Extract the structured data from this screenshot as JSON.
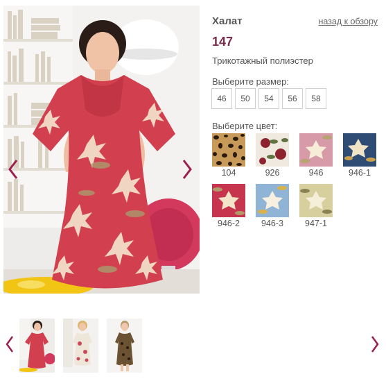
{
  "product": {
    "title": "Халат",
    "price": "147",
    "material": "Трикотажный полиэстер",
    "back_link": "назад к обзору"
  },
  "sizes": {
    "label": "Выберите размер:",
    "options": [
      "46",
      "50",
      "54",
      "56",
      "58"
    ]
  },
  "colors": {
    "label": "Выберите цвет:",
    "swatches": [
      {
        "code": "104",
        "pattern": "leopard",
        "base": "#c79a5a"
      },
      {
        "code": "926",
        "pattern": "floral",
        "base": "#efe9df"
      },
      {
        "code": "946",
        "pattern": "floral",
        "base": "#d79aa8"
      },
      {
        "code": "946-1",
        "pattern": "floral",
        "base": "#2f4c74"
      },
      {
        "code": "946-2",
        "pattern": "floral",
        "base": "#c7344d"
      },
      {
        "code": "946-3",
        "pattern": "floral",
        "base": "#8fb4d6"
      },
      {
        "code": "947-1",
        "pattern": "floral",
        "base": "#d7cf9e"
      }
    ]
  },
  "gallery": {
    "main_image": "model in red floral robe",
    "thumbnails": [
      {
        "description": "red floral robe",
        "active": true
      },
      {
        "description": "white floral robe",
        "active": false
      },
      {
        "description": "dark leopard robe",
        "active": false
      }
    ]
  },
  "icons": {
    "prev": "chevron-left-icon",
    "next": "chevron-right-icon"
  },
  "accent_color": "#9c1f4f"
}
